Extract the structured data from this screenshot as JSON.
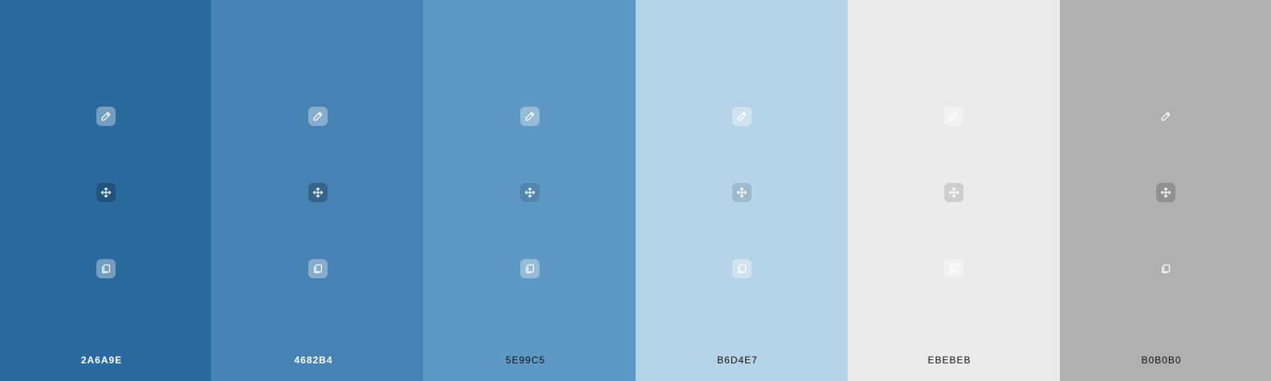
{
  "palette": {
    "swatches": [
      {
        "hex": "2A6A9E",
        "color": "#2A6A9E",
        "tone": "dark"
      },
      {
        "hex": "4682B4",
        "color": "#4682B4",
        "tone": "dark"
      },
      {
        "hex": "5E99C5",
        "color": "#5E99C5",
        "tone": "light"
      },
      {
        "hex": "B6D4E7",
        "color": "#B6D4E7",
        "tone": "light"
      },
      {
        "hex": "EBEBEB",
        "color": "#EBEBEB",
        "tone": "light"
      },
      {
        "hex": "B0B0B0",
        "color": "#B0B0B0",
        "tone": "gray"
      }
    ],
    "icons": {
      "pick": "eyedropper-icon",
      "move": "move-icon",
      "copy": "copy-icon"
    }
  }
}
